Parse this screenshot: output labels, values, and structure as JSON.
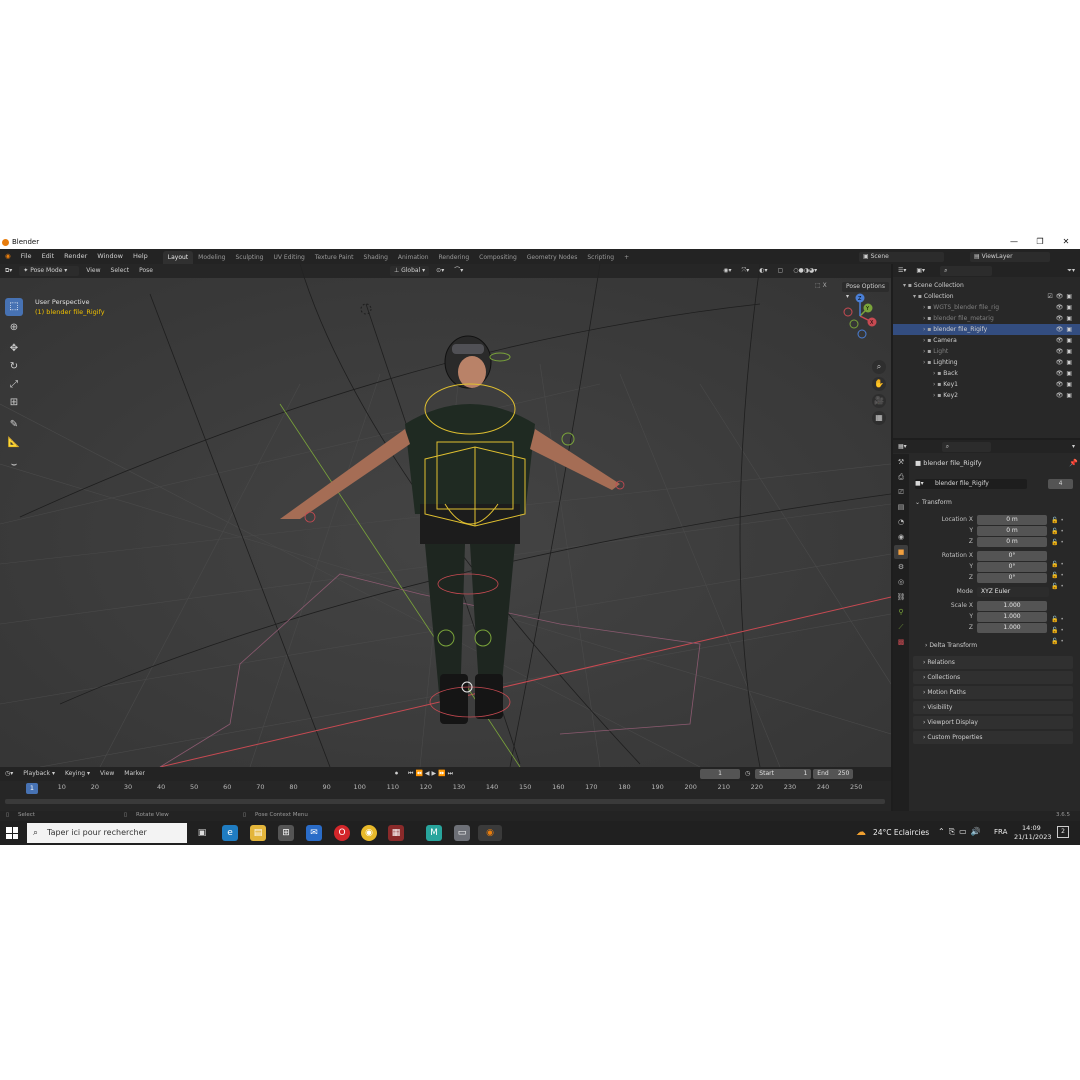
{
  "window": {
    "title": "Blender",
    "minimize": "—",
    "maximize": "❐",
    "close": "✕"
  },
  "menu": [
    "File",
    "Edit",
    "Render",
    "Window",
    "Help"
  ],
  "workspaces": [
    "Layout",
    "Modeling",
    "Sculpting",
    "UV Editing",
    "Texture Paint",
    "Shading",
    "Animation",
    "Rendering",
    "Compositing",
    "Geometry Nodes",
    "Scripting"
  ],
  "active_workspace": "Layout",
  "scene": {
    "label": "Scene",
    "viewlayer": "ViewLayer"
  },
  "viewport": {
    "mode": "Pose Mode",
    "menus": [
      "View",
      "Select",
      "Pose"
    ],
    "orientation": "Global",
    "pose_options": "Pose Options",
    "perspective": "User Perspective",
    "object_info": "(1) blender file_Rigify",
    "axes": {
      "x": "X",
      "y": "Y",
      "z": "Z"
    }
  },
  "outliner": {
    "rows": [
      {
        "label": "Scene Collection",
        "indent": 0,
        "state": "normal"
      },
      {
        "label": "Collection",
        "indent": 1,
        "state": "normal"
      },
      {
        "label": "WGTS_blender file_rig",
        "indent": 2,
        "state": "dim"
      },
      {
        "label": "blender file_metarig",
        "indent": 2,
        "state": "dim"
      },
      {
        "label": "blender file_Rigify",
        "indent": 2,
        "state": "selected"
      },
      {
        "label": "Camera",
        "indent": 2,
        "state": "normal"
      },
      {
        "label": "Light",
        "indent": 2,
        "state": "dim"
      },
      {
        "label": "Lighting",
        "indent": 2,
        "state": "normal"
      },
      {
        "label": "Back",
        "indent": 3,
        "state": "normal"
      },
      {
        "label": "Key1",
        "indent": 3,
        "state": "normal"
      },
      {
        "label": "Key2",
        "indent": 3,
        "state": "normal"
      }
    ]
  },
  "properties": {
    "object_name": "blender file_Rigify",
    "data_name": "blender file_Rigify",
    "data_users": "4",
    "transform_title": "Transform",
    "location": {
      "label": "Location X",
      "x": "0 m",
      "y": "0 m",
      "z": "0 m"
    },
    "rotation": {
      "label": "Rotation X",
      "x": "0°",
      "y": "0°",
      "z": "0°"
    },
    "mode": {
      "label": "Mode",
      "value": "XYZ Euler"
    },
    "scale": {
      "label": "Scale X",
      "x": "1.000",
      "y": "1.000",
      "z": "1.000"
    },
    "axis_y": "Y",
    "axis_z": "Z",
    "delta": "Delta Transform",
    "panels": [
      "Relations",
      "Collections",
      "Motion Paths",
      "Visibility",
      "Viewport Display",
      "Custom Properties"
    ]
  },
  "timeline": {
    "menus": [
      "Playback",
      "Keying",
      "View",
      "Marker"
    ],
    "current_frame": "1",
    "start_label": "Start",
    "start": "1",
    "end_label": "End",
    "end": "250",
    "ticks": [
      "10",
      "20",
      "30",
      "40",
      "50",
      "60",
      "70",
      "80",
      "90",
      "100",
      "110",
      "120",
      "130",
      "140",
      "150",
      "160",
      "170",
      "180",
      "190",
      "200",
      "210",
      "220",
      "230",
      "240",
      "250"
    ]
  },
  "statusbar": {
    "left": "Select",
    "mid": "Rotate View",
    "right": "Pose Context Menu",
    "version": "3.6.5"
  },
  "taskbar": {
    "search_placeholder": "Taper ici pour rechercher",
    "weather": "24°C  Eclaircies",
    "lang": "FRA",
    "time": "14:09",
    "date": "21/11/2023",
    "notifications": "2"
  },
  "colors": {
    "accent": "#4772b3",
    "selection": "#334d80",
    "viewport_bg": "#3b3b3b",
    "bone_yellow": "#e0c030",
    "axis_red": "#c84a52",
    "axis_green": "#7aa43a"
  }
}
